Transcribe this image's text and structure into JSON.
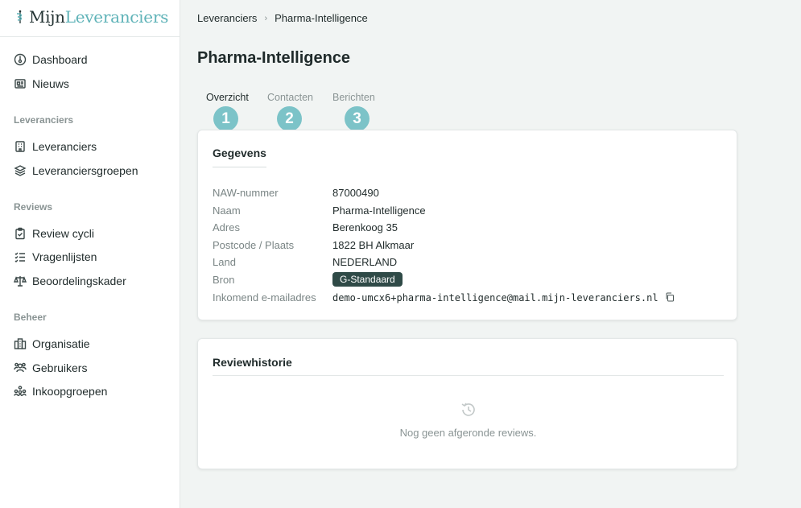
{
  "app": {
    "logo_part1": "Mijn",
    "logo_part2": "Leveranciers"
  },
  "sidebar": {
    "top_items": [
      {
        "label": "Dashboard",
        "icon": "dashboard-icon"
      },
      {
        "label": "Nieuws",
        "icon": "news-icon"
      }
    ],
    "sections": [
      {
        "title": "Leveranciers",
        "items": [
          {
            "label": "Leveranciers",
            "icon": "building-icon"
          },
          {
            "label": "Leveranciersgroepen",
            "icon": "layers-icon"
          }
        ]
      },
      {
        "title": "Reviews",
        "items": [
          {
            "label": "Review cycli",
            "icon": "clipboard-icon"
          },
          {
            "label": "Vragenlijsten",
            "icon": "checklist-icon"
          },
          {
            "label": "Beoordelingskader",
            "icon": "scale-icon"
          }
        ]
      },
      {
        "title": "Beheer",
        "items": [
          {
            "label": "Organisatie",
            "icon": "office-icon"
          },
          {
            "label": "Gebruikers",
            "icon": "users-icon"
          },
          {
            "label": "Inkoopgroepen",
            "icon": "groups-icon"
          }
        ]
      }
    ]
  },
  "breadcrumb": [
    "Leveranciers",
    "Pharma-Intelligence"
  ],
  "page_title": "Pharma-Intelligence",
  "tabs": [
    {
      "label": "Overzicht",
      "active": true,
      "step": "1"
    },
    {
      "label": "Contacten",
      "active": false,
      "step": "2"
    },
    {
      "label": "Berichten",
      "active": false,
      "step": "3"
    }
  ],
  "details": {
    "title": "Gegevens",
    "rows": [
      {
        "label": "NAW-nummer",
        "value": "87000490"
      },
      {
        "label": "Naam",
        "value": "Pharma-Intelligence"
      },
      {
        "label": "Adres",
        "value": "Berenkoog 35"
      },
      {
        "label": "Postcode / Plaats",
        "value": "1822 BH Alkmaar"
      },
      {
        "label": "Land",
        "value": "NEDERLAND"
      },
      {
        "label": "Bron",
        "value": "G-Standaard"
      },
      {
        "label": "Inkomend e-mailadres",
        "value": "demo-umcx6+pharma-intelligence@mail.mijn-leveranciers.nl"
      }
    ]
  },
  "review_history": {
    "title": "Reviewhistorie",
    "empty_text": "Nog geen afgeronde reviews."
  },
  "colors": {
    "accent": "#7cc3c8",
    "badge": "#2f4a47",
    "logo_teal": "#5fb3b8"
  }
}
